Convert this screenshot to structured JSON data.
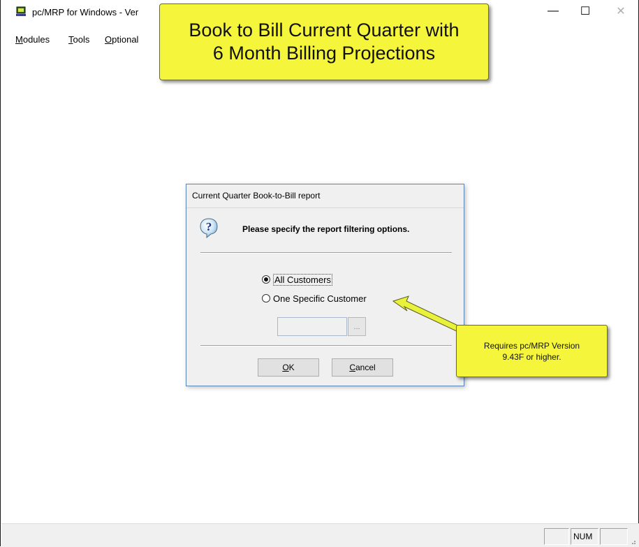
{
  "window": {
    "title": "pc/MRP for Windows - Ver",
    "minimize_glyph": "—",
    "maximize_glyph": "☐",
    "close_glyph": "✕"
  },
  "menu": {
    "items": [
      {
        "underline": "M",
        "rest": "odules"
      },
      {
        "underline": "T",
        "rest": "ools"
      },
      {
        "underline": "O",
        "rest": "ptional"
      }
    ]
  },
  "callouts": {
    "header_line1": "Book to Bill Current Quarter with",
    "header_line2": "6 Month Billing Projections",
    "note_line1": "Requires pc/MRP Version",
    "note_line2": "9.43F or higher."
  },
  "dialog": {
    "title": "Current Quarter Book-to-Bill report",
    "prompt": "Please specify the report filtering options.",
    "options": [
      {
        "label": "All Customers",
        "selected": true
      },
      {
        "label": "One Specific Customer",
        "selected": false
      }
    ],
    "customer_value": "",
    "browse_label": "...",
    "ok_underline": "O",
    "ok_rest": "K",
    "cancel_underline": "C",
    "cancel_rest": "ancel"
  },
  "statusbar": {
    "panes": [
      "",
      "NUM",
      ""
    ]
  },
  "colors": {
    "callout_fill": "#f5f53b",
    "arrow_fill": "#e8f23a",
    "dialog_border": "#5a86b6"
  }
}
